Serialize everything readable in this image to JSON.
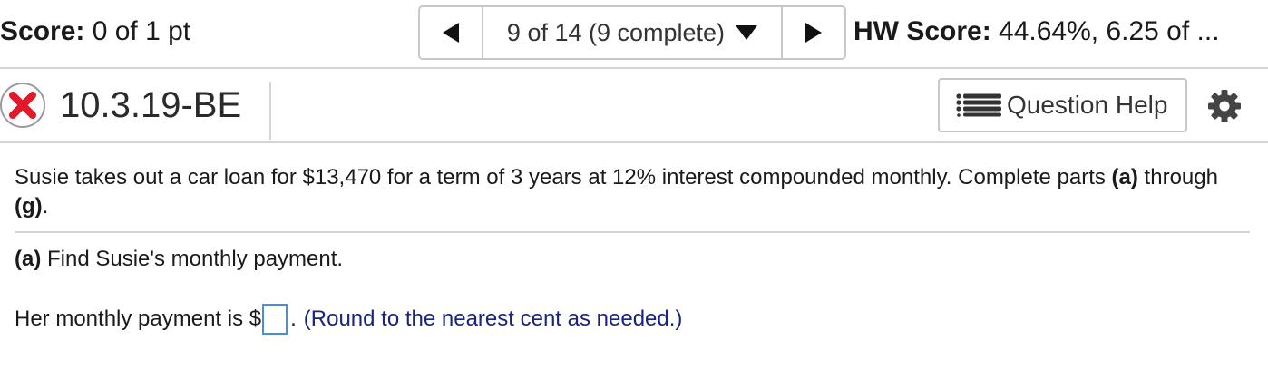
{
  "score": {
    "label": "Score:",
    "value": "0 of 1 pt"
  },
  "nav": {
    "progress": "9 of 14 (9 complete)"
  },
  "hw_score": {
    "label": "HW Score:",
    "value": "44.64%, 6.25 of ..."
  },
  "question": {
    "id": "10.3.19-BE",
    "status": "incorrect",
    "help_label": "Question Help"
  },
  "problem": {
    "intro_text": "Susie takes out a car loan for $13,470 for a term of 3 years at 12% interest compounded monthly. Complete parts ",
    "intro_a": "(a)",
    "intro_through": " through ",
    "intro_g": "(g)",
    "intro_end": "."
  },
  "part_a": {
    "label": "(a)",
    "prompt": " Find Susie's monthly payment.",
    "answer_prefix": "Her monthly payment is $",
    "answer_value": "",
    "answer_suffix": ".",
    "hint": "(Round to the nearest cent as needed.)"
  },
  "colors": {
    "border": "#c8c8c8",
    "rule": "#d4d4d4",
    "hint": "#1a237e",
    "input_border": "#4a8fd4",
    "x_red": "#e0192b"
  },
  "icons": [
    "left-arrow-icon",
    "dropdown-caret-icon",
    "right-arrow-icon",
    "incorrect-x-icon",
    "list-icon",
    "gear-icon"
  ]
}
